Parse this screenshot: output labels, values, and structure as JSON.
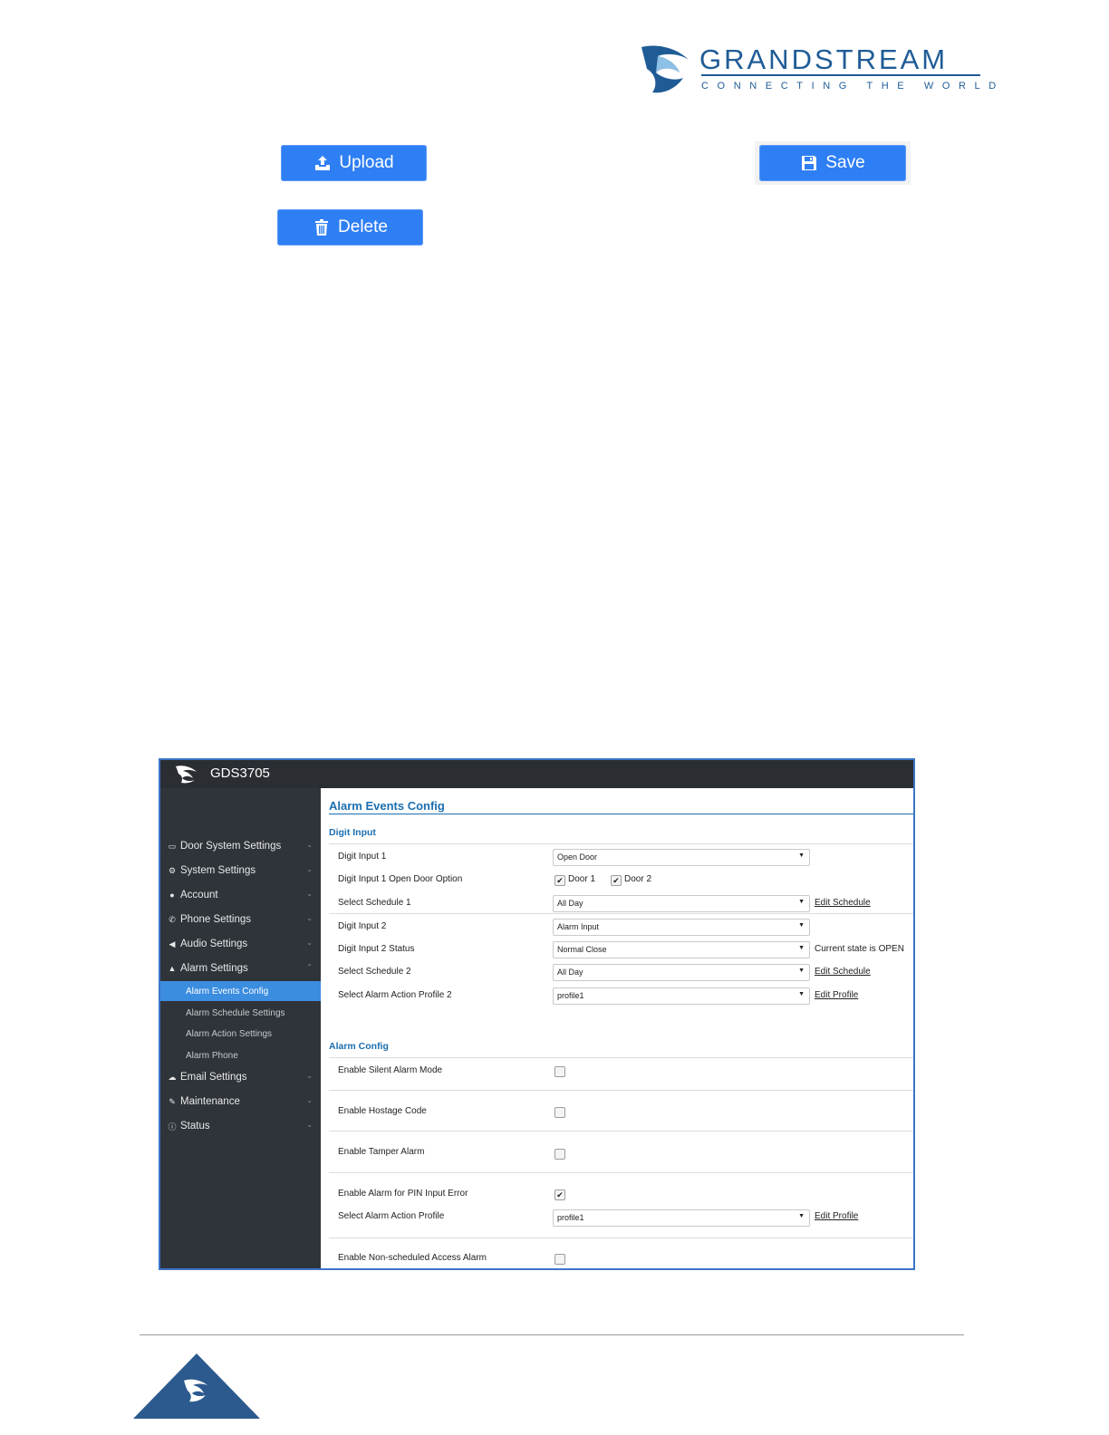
{
  "header": {
    "brand_name": "GRANDSTREAM",
    "brand_tagline": "CONNECTING THE WORLD",
    "brand_color": "#1f5c96"
  },
  "buttons": {
    "upload": {
      "label": "Upload",
      "icon": "upload-icon"
    },
    "save": {
      "label": "Save",
      "icon": "save-icon"
    },
    "delete": {
      "label": "Delete",
      "icon": "trash-icon"
    },
    "color": "#2f7ff4"
  },
  "screenshot": {
    "model": "GDS3705",
    "sidebar": {
      "items": [
        {
          "label": "Door System Settings",
          "icon": "card-icon"
        },
        {
          "label": "System Settings",
          "icon": "wrench-icon"
        },
        {
          "label": "Account",
          "icon": "user-icon"
        },
        {
          "label": "Phone Settings",
          "icon": "phone-icon"
        },
        {
          "label": "Audio Settings",
          "icon": "speaker-icon"
        },
        {
          "label": "Alarm Settings",
          "icon": "bell-icon"
        }
      ],
      "alarm_sub": [
        {
          "label": "Alarm Events Config",
          "active": true
        },
        {
          "label": "Alarm Schedule Settings"
        },
        {
          "label": "Alarm Action Settings"
        },
        {
          "label": "Alarm Phone"
        }
      ],
      "items_after": [
        {
          "label": "Email Settings",
          "icon": "cloud-icon"
        },
        {
          "label": "Maintenance",
          "icon": "tools-icon"
        },
        {
          "label": "Status",
          "icon": "info-icon"
        }
      ],
      "active_color": "#3b8de0"
    },
    "main": {
      "title": "Alarm Events Config",
      "digit_input": {
        "section": "Digit Input",
        "rows": {
          "digit_input_1": {
            "label": "Digit Input 1",
            "value": "Open Door"
          },
          "open_door_option": {
            "label": "Digit Input 1 Open Door Option",
            "door1": "Door 1",
            "door2": "Door 2",
            "door1_checked": true,
            "door2_checked": true
          },
          "schedule_1": {
            "label": "Select Schedule 1",
            "value": "All Day",
            "link": "Edit Schedule"
          },
          "digit_input_2": {
            "label": "Digit Input 2",
            "value": "Alarm Input"
          },
          "digit_input_2_status": {
            "label": "Digit Input 2 Status",
            "value": "Normal Close",
            "note": "Current state is OPEN"
          },
          "schedule_2": {
            "label": "Select Schedule 2",
            "value": "All Day",
            "link": "Edit Schedule"
          },
          "action_profile_2": {
            "label": "Select Alarm Action Profile 2",
            "value": "profile1",
            "link": "Edit Profile"
          }
        }
      },
      "alarm_config": {
        "section": "Alarm Config",
        "rows": {
          "silent": {
            "label": "Enable Silent Alarm Mode",
            "checked": false
          },
          "hostage": {
            "label": "Enable Hostage Code",
            "checked": false
          },
          "tamper": {
            "label": "Enable Tamper Alarm",
            "checked": false
          },
          "pin_error": {
            "label": "Enable Alarm for PIN Input Error",
            "checked": true
          },
          "action_profile": {
            "label": "Select Alarm Action Profile",
            "value": "profile1",
            "link": "Edit Profile"
          },
          "non_scheduled": {
            "label": "Enable Non-scheduled Access Alarm",
            "checked": false
          }
        }
      }
    }
  }
}
